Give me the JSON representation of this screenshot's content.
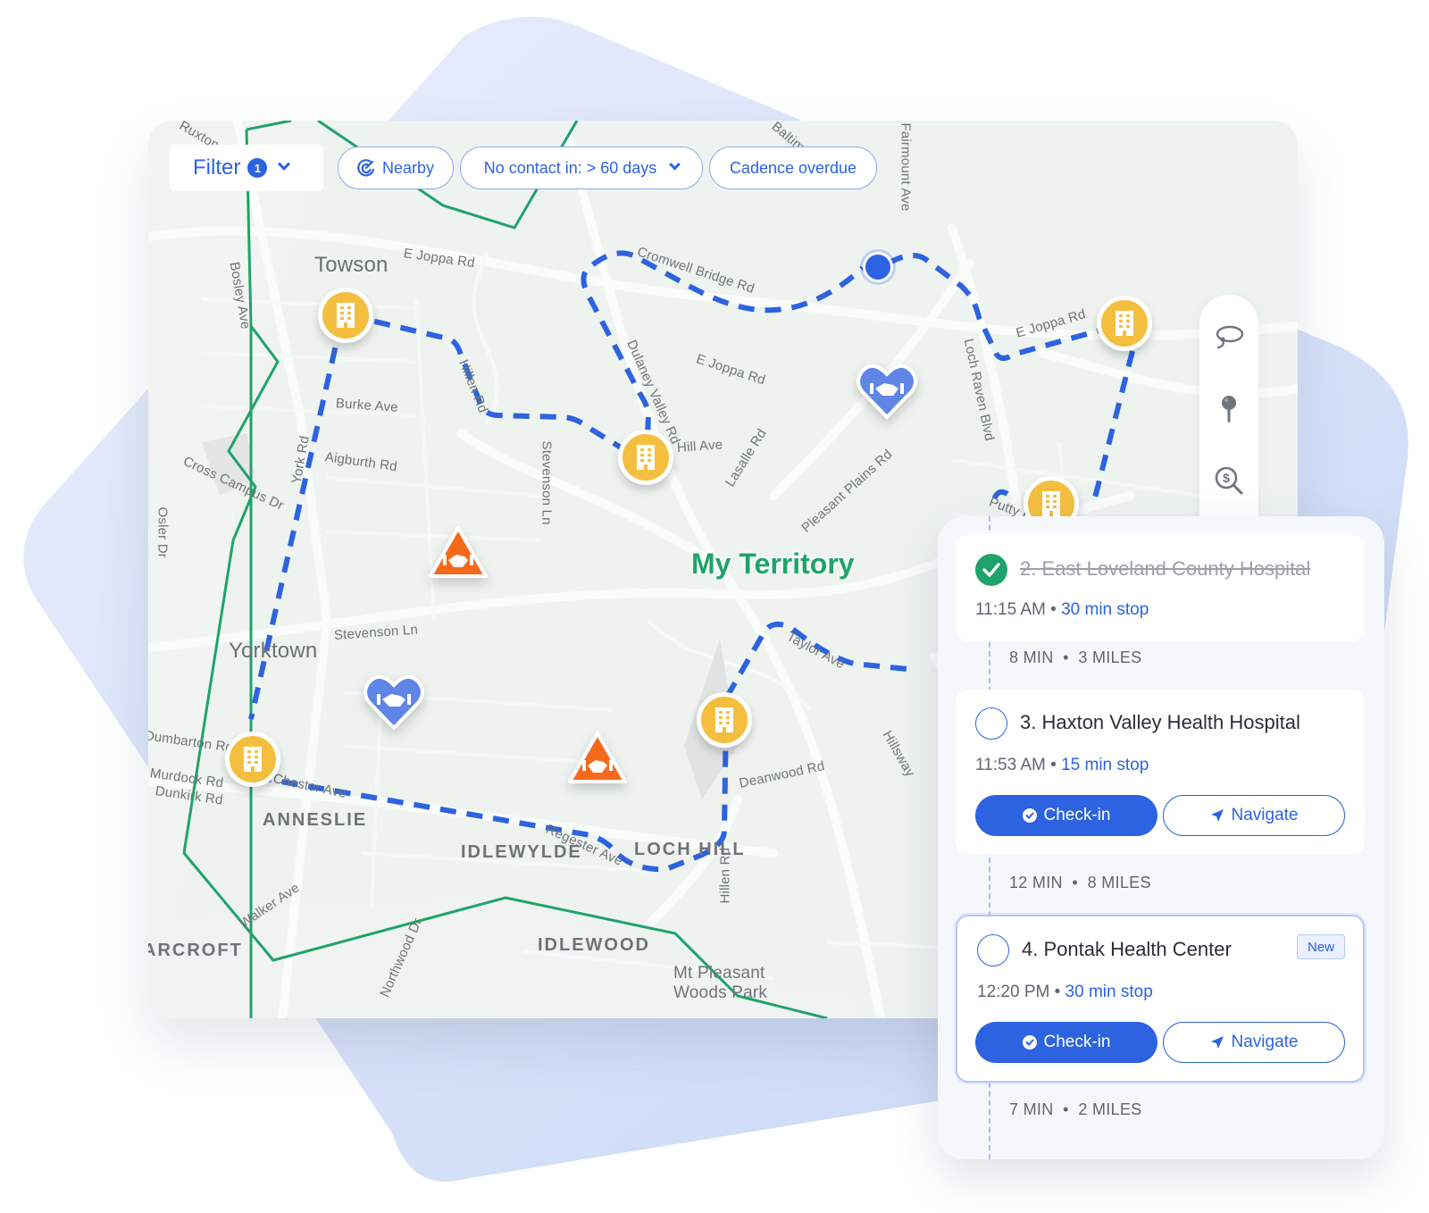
{
  "colors": {
    "accent": "#2d63e0",
    "territory": "#1fa36a",
    "building_marker": "#f4bf3f",
    "heart_marker": "#5f86e6",
    "triangle_marker": "#f56a1a",
    "backdrop": "#dbe4fa"
  },
  "filters": {
    "filter_label": "Filter",
    "filter_count": "1",
    "chips": [
      {
        "label": "Nearby",
        "icon": "nearby-radar-icon",
        "has_dropdown": false
      },
      {
        "label": "No contact in: > 60 days",
        "icon": null,
        "has_dropdown": true
      },
      {
        "label": "Cadence overdue",
        "icon": null,
        "has_dropdown": false
      }
    ]
  },
  "map": {
    "territory_label": "My Territory",
    "town_labels": [
      "Towson",
      "Yorktown"
    ],
    "area_labels": [
      "ANNESLIE",
      "IDLEWYLDE",
      "LOCH HILL",
      "IDLEWOOD",
      "ARCROFT"
    ],
    "street_labels": [
      "E Joppa Rd",
      "Bosley Ave",
      "Burke Ave",
      "Aigburth Rd",
      "Hillen Rd",
      "Stevenson Ln",
      "Cross Campus Dr",
      "Osler Dr",
      "York Rd",
      "Cromwell Bridge Rd",
      "Dulaney Valley Rd",
      "E Joppa Rd",
      "Hill Ave",
      "Lasalle Rd",
      "Pleasant Plains Rd",
      "Loch Raven Blvd",
      "E Joppa Rd",
      "Putty Hill Ave",
      "Stevenson Ln",
      "Dumbarton Rd",
      "Murdock Rd",
      "Dunkirk Rd",
      "Chester Ave",
      "Regester Ave",
      "Taylor Ave",
      "Hillsway",
      "Deanwood Rd",
      "Hillen Rd",
      "Walker Ave",
      "Northwood Dr",
      "Mt Pleasant",
      "Woods Park",
      "Baltimore",
      "Fairmount Ave",
      "Ruxton Dr"
    ],
    "markers": [
      {
        "type": "building",
        "name": "account-marker"
      },
      {
        "type": "building",
        "name": "account-marker"
      },
      {
        "type": "building",
        "name": "account-marker"
      },
      {
        "type": "building",
        "name": "account-marker"
      },
      {
        "type": "building",
        "name": "account-marker"
      },
      {
        "type": "building",
        "name": "account-marker"
      },
      {
        "type": "heart",
        "name": "relationship-marker"
      },
      {
        "type": "heart",
        "name": "relationship-marker"
      },
      {
        "type": "triangle",
        "name": "at-risk-marker"
      },
      {
        "type": "triangle",
        "name": "at-risk-marker"
      }
    ],
    "tools": [
      "lasso-icon",
      "pin-icon",
      "dollar-search-icon"
    ]
  },
  "route": {
    "stops": [
      {
        "title": "2. East Loveland County Hospital",
        "time": "11:15 AM",
        "separator": "•",
        "duration": "30 min stop",
        "completed": true,
        "badge": null
      },
      {
        "title": "3. Haxton Valley Health Hospital",
        "time": "11:53 AM",
        "separator": "•",
        "duration": "15 min stop",
        "completed": false,
        "badge": null
      },
      {
        "title": "4. Pontak Health Center",
        "time": "12:20 PM",
        "separator": "•",
        "duration": "30 min stop",
        "completed": false,
        "badge": "New"
      }
    ],
    "legs": [
      {
        "time": "8 MIN",
        "distance": "3 MILES"
      },
      {
        "time": "12 MIN",
        "distance": "8 MILES"
      },
      {
        "time": "7 MIN",
        "distance": "2 MILES"
      }
    ],
    "checkin_label": "Check-in",
    "navigate_label": "Navigate"
  }
}
